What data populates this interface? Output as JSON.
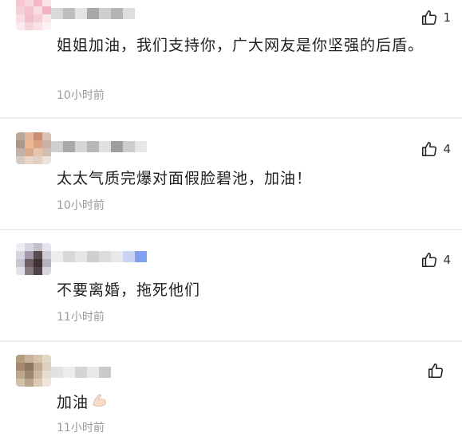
{
  "comments": [
    {
      "text": "姐姐加油，我们支持你，广大网友是你坚强的后盾。",
      "time": "10小时前",
      "likes": "1",
      "avatar_colors": [
        "#f4c7d0",
        "#f7d8de",
        "#f1b9c4",
        "#f9e3e7"
      ],
      "name_colors": [
        "#d9d9d9",
        "#bdbdbd",
        "#e3e3e3",
        "#a8a8a8",
        "#cfcfcf",
        "#b5b5b5",
        "#dedede"
      ]
    },
    {
      "text": "太太气质完爆对面假脸碧池，加油！",
      "time": "10小时前",
      "likes": "4",
      "avatar_colors": [
        "#b9a79a",
        "#e4b79a",
        "#c98f74",
        "#d8c2b4"
      ],
      "name_colors": [
        "#cfcfcf",
        "#a9a9a9",
        "#d6d6d6",
        "#b8b8b8",
        "#e0e0e0",
        "#9f9f9f",
        "#cccccc",
        "#e7e7e7"
      ]
    },
    {
      "text": "不要离婚，拖死他们",
      "time": "11小时前",
      "likes": "4",
      "avatar_colors": [
        "#d9d6e3",
        "#5a4b4f",
        "#a39aa8",
        "#c4c0cc"
      ],
      "name_colors": [
        "#eeeeee",
        "#d8d8d8",
        "#e6e6e6",
        "#cfcfcf",
        "#dcdcdc",
        "#e9e9e9",
        "#c9d4f3",
        "#7fa1f0"
      ]
    },
    {
      "text": "加油",
      "time": "11小时前",
      "likes": "",
      "avatar_colors": [
        "#b59d80",
        "#c8b49c",
        "#8f7862",
        "#d4c3ae"
      ],
      "name_colors": [
        "#e2e2e2",
        "#ededed",
        "#d4d4d4",
        "#e8e8e8",
        "#cacaca"
      ]
    }
  ],
  "icons": {
    "like": "thumbs-up-icon",
    "flexed_biceps": "flexed-biceps-emoji"
  },
  "colors": {
    "text": "#1f1f1f",
    "time": "#9a9a9a",
    "divider": "#ececec"
  }
}
